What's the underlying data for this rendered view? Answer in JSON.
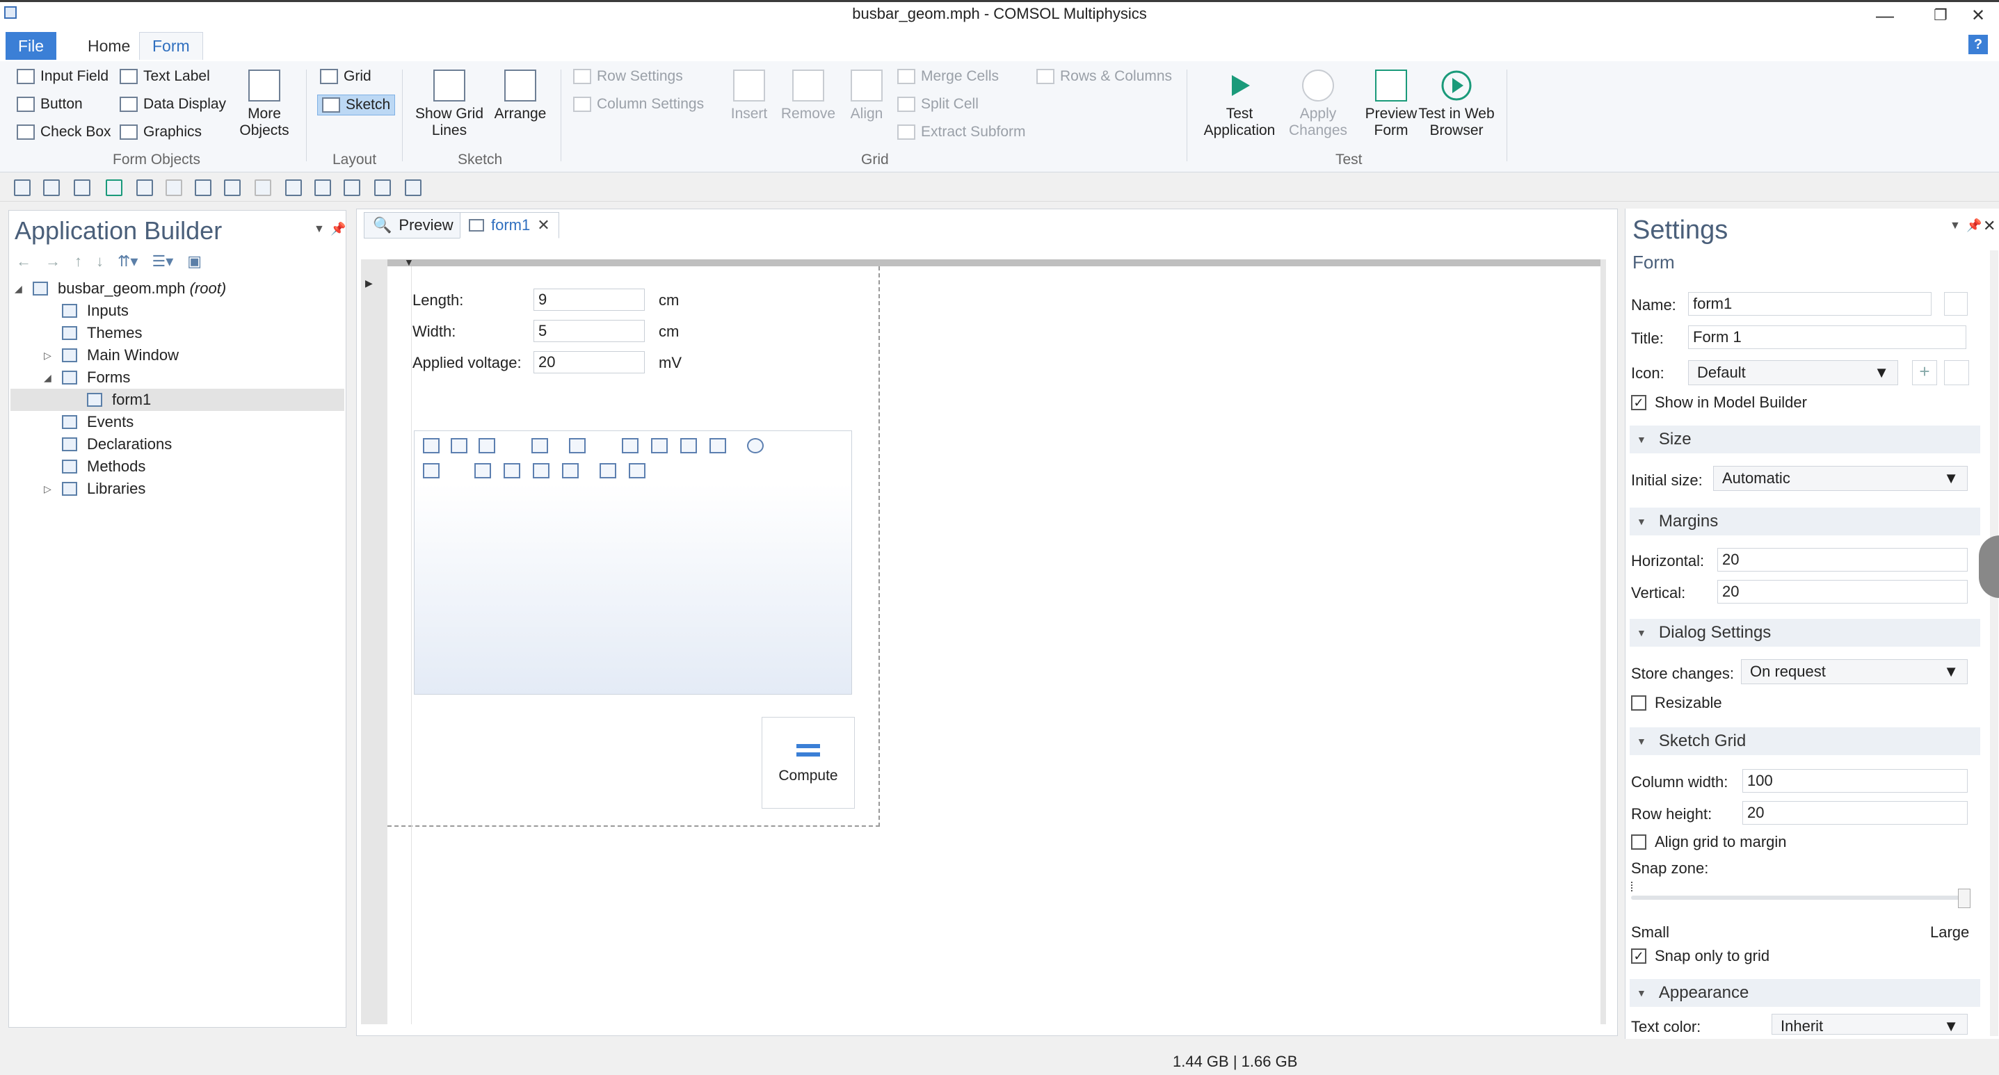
{
  "window": {
    "title": "busbar_geom.mph - COMSOL Multiphysics",
    "minimize": "—",
    "restore": "❐",
    "close": "✕"
  },
  "ribbon_tabs": {
    "file": "File",
    "home": "Home",
    "form": "Form",
    "help": "?"
  },
  "ribbon": {
    "form_objects": {
      "group": "Form Objects",
      "input_field": "Input Field",
      "text_label": "Text Label",
      "button": "Button",
      "data_display": "Data Display",
      "check_box": "Check Box",
      "graphics": "Graphics",
      "more_objects": "More Objects"
    },
    "layout": {
      "group": "Layout",
      "grid": "Grid",
      "sketch": "Sketch"
    },
    "sketch": {
      "group": "Sketch",
      "show_grid_lines": "Show Grid Lines",
      "arrange": "Arrange"
    },
    "grid": {
      "group": "Grid",
      "row_settings": "Row Settings",
      "column_settings": "Column Settings",
      "insert": "Insert",
      "remove": "Remove",
      "align": "Align",
      "merge_cells": "Merge Cells",
      "split_cell": "Split Cell",
      "extract_subform": "Extract Subform",
      "rows_columns": "Rows & Columns"
    },
    "test": {
      "group": "Test",
      "test_application": "Test Application",
      "apply_changes": "Apply Changes",
      "preview_form": "Preview Form",
      "test_in_web_browser": "Test in Web Browser"
    }
  },
  "app_builder": {
    "title": "Application Builder",
    "root": "busbar_geom.mph",
    "root_suffix": "(root)",
    "items": [
      "Inputs",
      "Themes",
      "Main Window",
      "Forms",
      "form1",
      "Events",
      "Declarations",
      "Methods",
      "Libraries"
    ]
  },
  "editor": {
    "tabs": {
      "preview": "Preview",
      "form1": "form1"
    },
    "fields": [
      {
        "label": "Length:",
        "value": "9",
        "unit": "cm"
      },
      {
        "label": "Width:",
        "value": "5",
        "unit": "cm"
      },
      {
        "label": "Applied voltage:",
        "value": "20",
        "unit": "mV"
      }
    ],
    "compute": "Compute"
  },
  "settings": {
    "title": "Settings",
    "subtitle": "Form",
    "name_label": "Name:",
    "name": "form1",
    "title_label": "Title:",
    "title_value": "Form 1",
    "icon_label": "Icon:",
    "icon": "Default",
    "show_in_model_builder": "Show in Model Builder",
    "size_section": "Size",
    "initial_size_label": "Initial size:",
    "initial_size": "Automatic",
    "margins_section": "Margins",
    "horizontal_label": "Horizontal:",
    "horizontal": "20",
    "vertical_label": "Vertical:",
    "vertical": "20",
    "dialog_section": "Dialog Settings",
    "store_changes_label": "Store changes:",
    "store_changes": "On request",
    "resizable": "Resizable",
    "sketch_grid_section": "Sketch Grid",
    "column_width_label": "Column width:",
    "column_width": "100",
    "row_height_label": "Row height:",
    "row_height": "20",
    "align_grid": "Align grid to margin",
    "snap_zone_label": "Snap zone:",
    "snap_small": "Small",
    "snap_large": "Large",
    "snap_only": "Snap only to grid",
    "appearance_section": "Appearance",
    "text_color_label": "Text color:",
    "text_color": "Inherit"
  },
  "status": {
    "memory": "1.44 GB | 1.66 GB"
  }
}
